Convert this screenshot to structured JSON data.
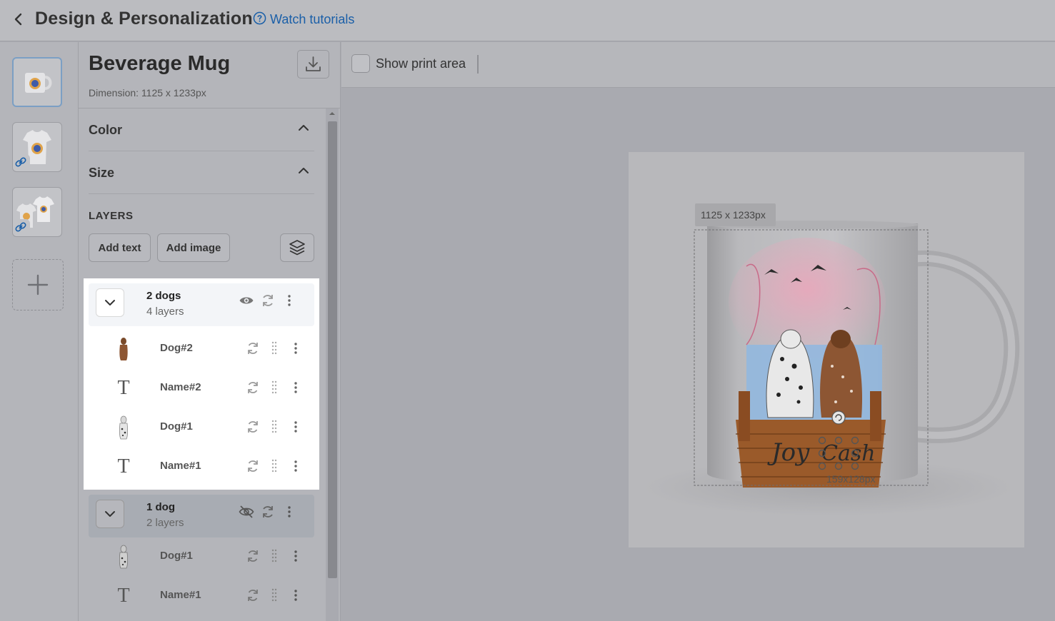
{
  "header": {
    "title": "Design & Personalization",
    "tutorials_label": "Watch tutorials"
  },
  "product": {
    "name": "Beverage Mug",
    "dimension": "Dimension: 1125 x 1233px"
  },
  "sections": [
    {
      "label": "Color"
    },
    {
      "label": "Size"
    }
  ],
  "layers": {
    "heading": "LAYERS",
    "add_text": "Add text",
    "add_image": "Add image"
  },
  "groups": [
    {
      "name": "2 dogs",
      "count": "4 layers",
      "visible": true,
      "items": [
        {
          "name": "Dog#2",
          "kind": "image"
        },
        {
          "name": "Name#2",
          "kind": "text"
        },
        {
          "name": "Dog#1",
          "kind": "image"
        },
        {
          "name": "Name#1",
          "kind": "text"
        }
      ]
    },
    {
      "name": "1 dog",
      "count": "2 layers",
      "visible": false,
      "items": [
        {
          "name": "Dog#1",
          "kind": "image"
        },
        {
          "name": "Name#1",
          "kind": "text"
        }
      ]
    }
  ],
  "toolbar": {
    "show_print_area": "Show print area"
  },
  "canvas": {
    "size_tag": "1125 x 1233px",
    "selection_tag": "159x128px",
    "name_left": "Joy",
    "name_right": "Cash"
  },
  "colors": {
    "accent_link": "#1a5fa8",
    "sky_pink": "#e9a7bb",
    "sea_blue": "#8fb7e0",
    "dock_brown": "#9a5a2a"
  }
}
